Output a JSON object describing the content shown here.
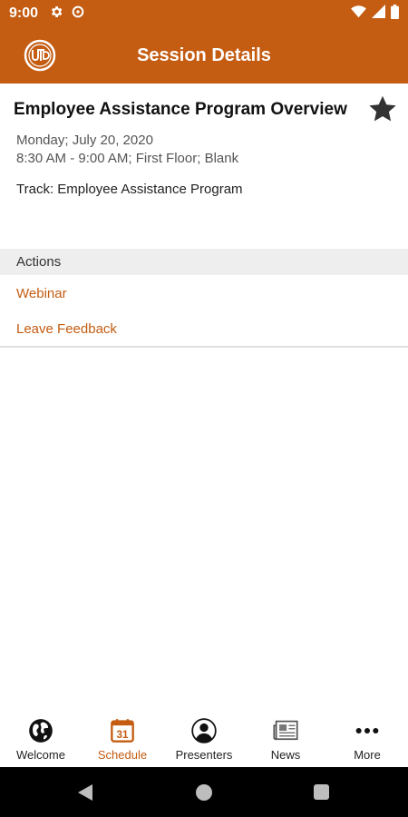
{
  "status_bar": {
    "time": "9:00",
    "icons": [
      "gear-icon",
      "data-saver-icon",
      "wifi-icon",
      "signal-icon",
      "battery-icon"
    ]
  },
  "app_bar": {
    "title": "Session Details",
    "logo_icon": "utd-logo-icon"
  },
  "session": {
    "title": "Employee Assistance Program Overview",
    "date": "Monday; July 20, 2020",
    "time_location": "8:30 AM - 9:00 AM; First Floor; Blank",
    "track": "Track: Employee Assistance Program",
    "favorite_icon": "star-icon"
  },
  "actions": {
    "header": "Actions",
    "items": [
      {
        "label": "Webinar"
      },
      {
        "label": "Leave Feedback"
      }
    ]
  },
  "bottom_nav": {
    "items": [
      {
        "label": "Welcome",
        "icon": "globe-icon",
        "active": false
      },
      {
        "label": "Schedule",
        "icon": "calendar-icon",
        "calendar_day": "31",
        "active": true
      },
      {
        "label": "Presenters",
        "icon": "person-icon",
        "active": false
      },
      {
        "label": "News",
        "icon": "newspaper-icon",
        "active": false
      },
      {
        "label": "More",
        "icon": "more-dots-icon",
        "active": false
      }
    ]
  },
  "system_nav": {
    "icons": [
      "back-icon",
      "home-icon",
      "recents-icon"
    ]
  },
  "colors": {
    "brand": "#c45c12",
    "section_bg": "#eeeeee",
    "text_secondary": "#555555"
  }
}
